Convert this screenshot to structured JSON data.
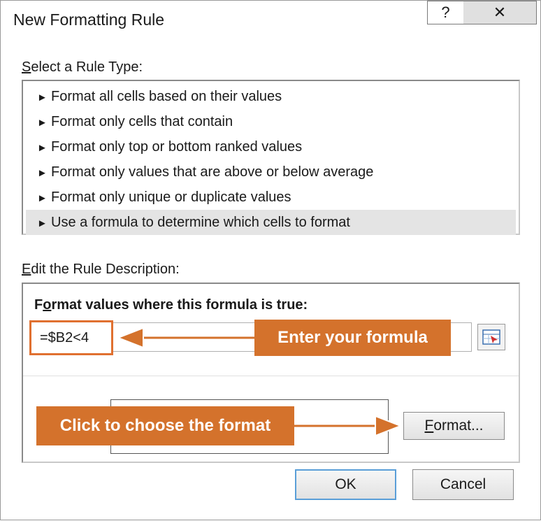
{
  "window": {
    "title": "New Formatting Rule",
    "help_label": "?",
    "close_label": "✕"
  },
  "rule_type": {
    "label_accel": "S",
    "label_rest": "elect a Rule Type:",
    "items": [
      {
        "label": "Format all cells based on their values"
      },
      {
        "label": "Format only cells that contain"
      },
      {
        "label": "Format only top or bottom ranked values"
      },
      {
        "label": "Format only values that are above or below average"
      },
      {
        "label": "Format only unique or duplicate values"
      },
      {
        "label": "Use a formula to determine which cells to format"
      }
    ],
    "selected_index": 5,
    "bullet": "►"
  },
  "description": {
    "label_accel": "E",
    "label_rest": "dit the Rule Description:",
    "formula_label_pre": "F",
    "formula_label_accel": "o",
    "formula_label_rest": "rmat values where this formula is true:",
    "formula_value": "=$B2<4"
  },
  "callouts": {
    "formula": "Enter your formula",
    "format": "Click to choose the format"
  },
  "buttons": {
    "format_accel": "F",
    "format_rest": "ormat...",
    "ok": "OK",
    "cancel": "Cancel"
  },
  "colors": {
    "callout": "#d4722c",
    "ok_border": "#5a9fd8"
  }
}
